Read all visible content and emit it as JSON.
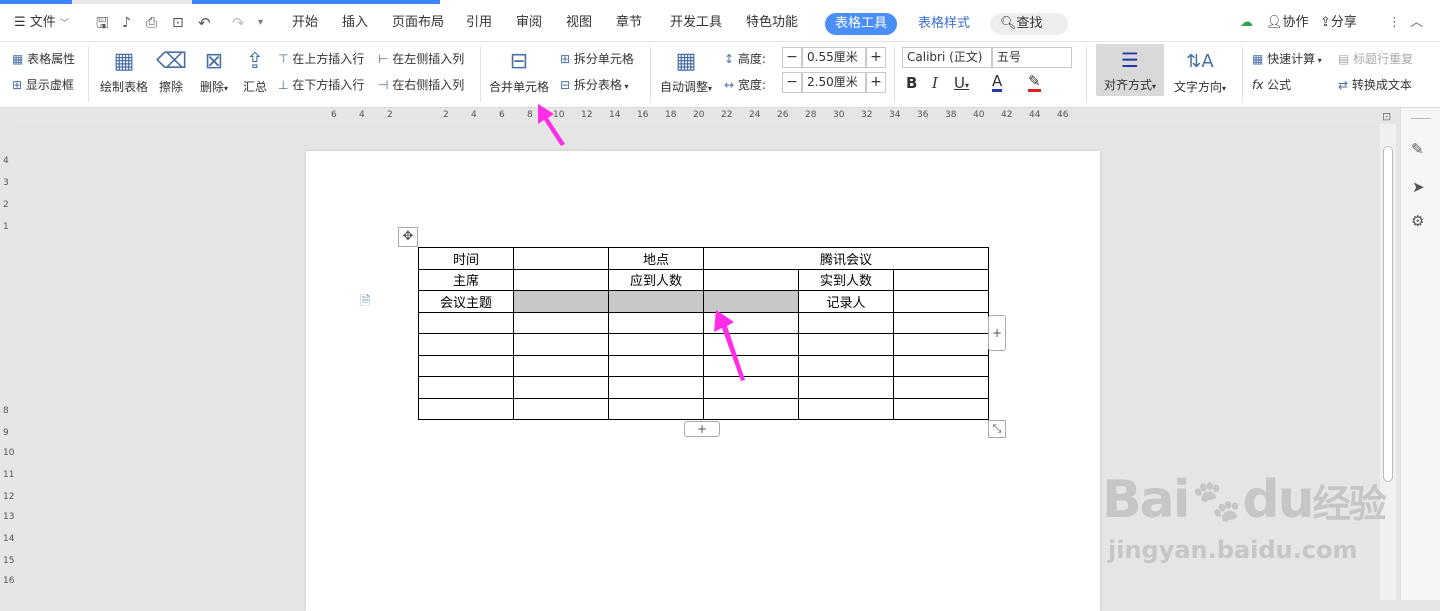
{
  "menubar": {
    "file": "文件",
    "tabs": [
      "开始",
      "插入",
      "页面布局",
      "引用",
      "审阅",
      "视图",
      "章节",
      "开发工具",
      "特色功能"
    ],
    "active_tab": "表格工具",
    "tab_style": "表格样式",
    "search": "查找",
    "collab": "协作",
    "share": "分享"
  },
  "ribbon": {
    "table_props": "表格属性",
    "show_grid": "显示虚框",
    "draw_table": "绘制表格",
    "erase": "擦除",
    "delete": "删除",
    "summary": "汇总",
    "insert_above": "在上方插入行",
    "insert_below": "在下方插入行",
    "insert_left": "在左侧插入列",
    "insert_right": "在右侧插入列",
    "merge_cells": "合并单元格",
    "split_cells": "拆分单元格",
    "split_table": "拆分表格",
    "auto_fit": "自动调整",
    "height_label": "高度:",
    "height_value": "0.55厘米",
    "width_label": "宽度:",
    "width_value": "2.50厘米",
    "font_name": "Calibri (正文)",
    "font_size": "五号",
    "align": "对齐方式",
    "text_dir": "文字方向",
    "quick_calc": "快速计算",
    "formula": "公式",
    "header_repeat": "标题行重复",
    "to_text": "转换成文本"
  },
  "ruler": {
    "h": [
      "6",
      "4",
      "2",
      "2",
      "4",
      "6",
      "8",
      "10",
      "12",
      "14",
      "16",
      "18",
      "20",
      "22",
      "24",
      "26",
      "28",
      "30",
      "32",
      "34",
      "36",
      "38",
      "40",
      "42",
      "44",
      "46"
    ],
    "v": [
      "4",
      "3",
      "2",
      "1",
      "8",
      "9",
      "10",
      "11",
      "12",
      "13",
      "14",
      "15",
      "16"
    ]
  },
  "table": {
    "r1": [
      "时间",
      "",
      "地点",
      "腾讯会议"
    ],
    "r2": [
      "主席",
      "",
      "应到人数",
      "",
      "实到人数",
      ""
    ],
    "r3": [
      "会议主题",
      "",
      "",
      "",
      "记录人",
      ""
    ]
  },
  "watermark": {
    "brand": "Bai",
    "brand2": "du",
    "cn": "经验",
    "url": "jingyan.baidu.com"
  },
  "colors": {
    "accent": "#3b82f6",
    "arrow": "#ff2ee6",
    "active_pill": "#4a8ff7"
  }
}
